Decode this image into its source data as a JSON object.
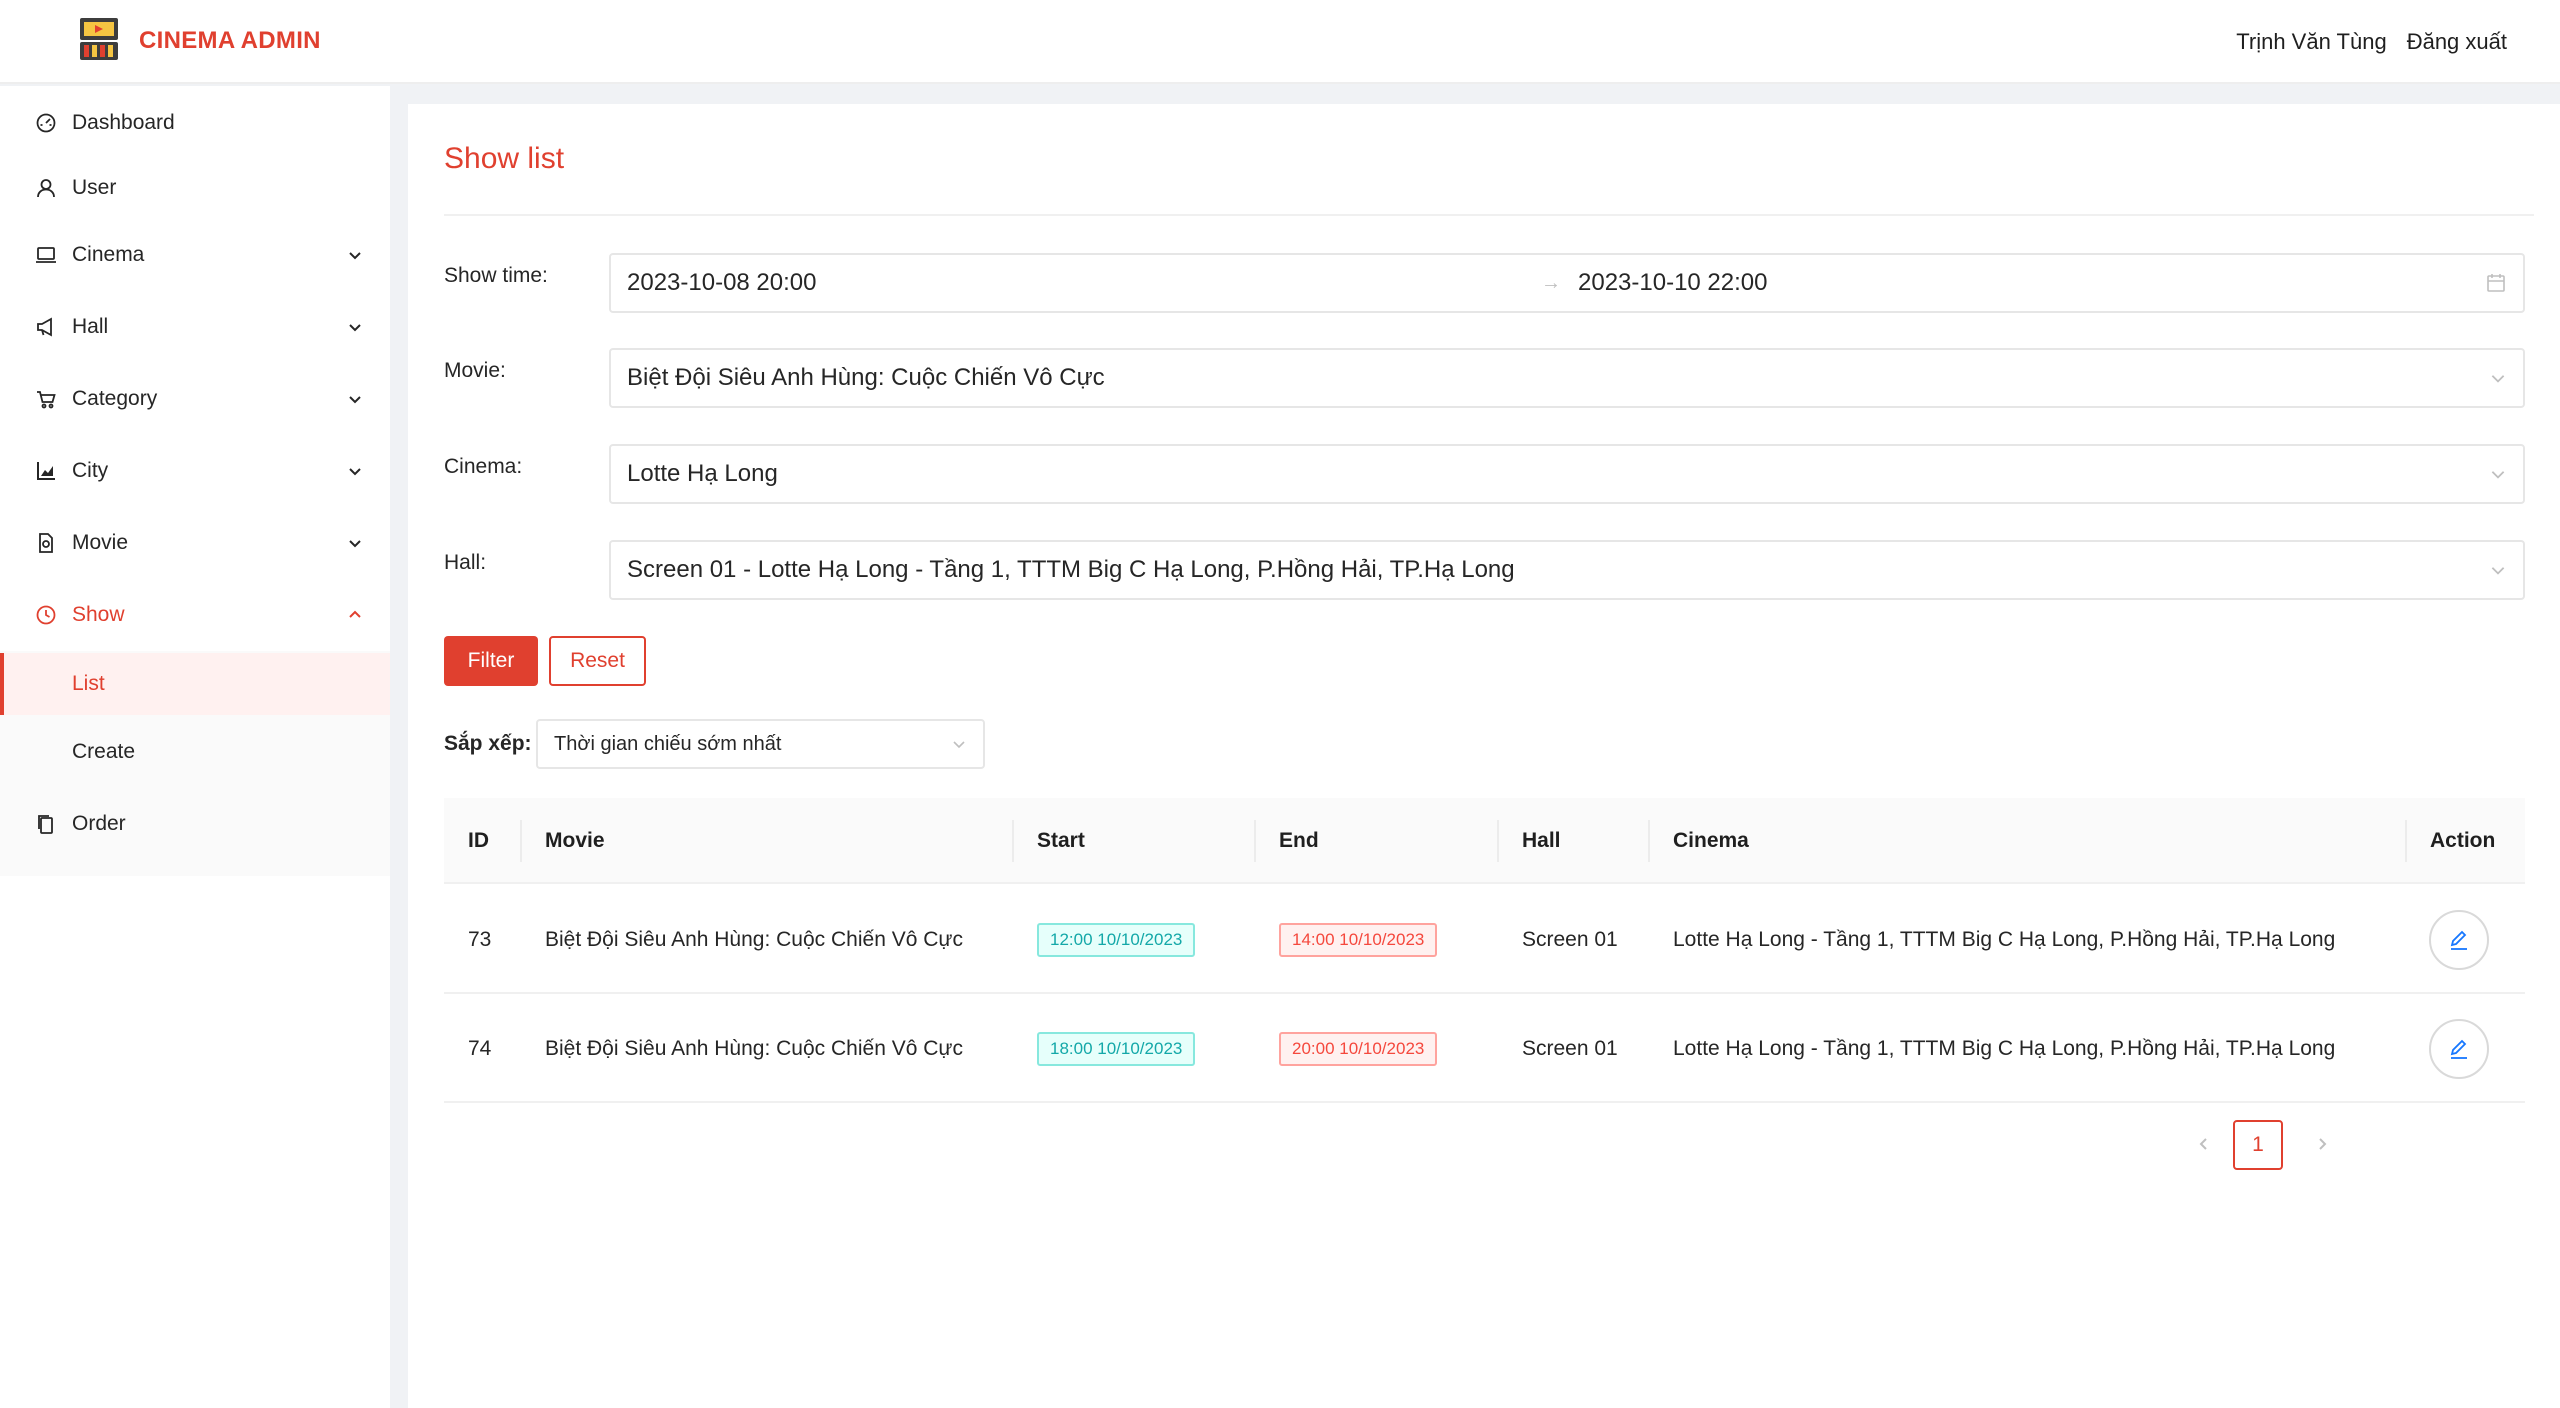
{
  "header": {
    "app_title": "CINEMA ADMIN",
    "user_name": "Trịnh Văn Tùng",
    "logout_label": "Đăng xuất"
  },
  "sidebar": {
    "items": [
      {
        "label": "Dashboard",
        "icon": "dashboard-icon"
      },
      {
        "label": "User",
        "icon": "user-icon"
      },
      {
        "label": "Cinema",
        "icon": "laptop-icon"
      },
      {
        "label": "Hall",
        "icon": "megaphone-icon"
      },
      {
        "label": "Category",
        "icon": "cart-icon"
      },
      {
        "label": "City",
        "icon": "chart-icon"
      },
      {
        "label": "Movie",
        "icon": "file-icon"
      },
      {
        "label": "Show",
        "icon": "clock-icon"
      },
      {
        "label": "Order",
        "icon": "copy-icon"
      }
    ],
    "show_submenu": [
      {
        "label": "List"
      },
      {
        "label": "Create"
      }
    ]
  },
  "page": {
    "title": "Show list"
  },
  "filters": {
    "show_time_label": "Show time",
    "show_time_start": "2023-10-08 20:00",
    "show_time_end": "2023-10-10 22:00",
    "movie_label": "Movie",
    "movie_value": "Biệt Đội Siêu Anh Hùng: Cuộc Chiến Vô Cực",
    "cinema_label": "Cinema",
    "cinema_value": "Lotte Hạ Long",
    "hall_label": "Hall",
    "hall_value": "Screen 01 - Lotte Hạ Long - Tầng 1, TTTM Big C Hạ Long, P.Hồng Hải, TP.Hạ Long",
    "filter_button": "Filter",
    "reset_button": "Reset"
  },
  "sort": {
    "label": "Sắp xếp:",
    "value": "Thời gian chiếu sớm nhất"
  },
  "table": {
    "headers": {
      "id": "ID",
      "movie": "Movie",
      "start": "Start",
      "end": "End",
      "hall": "Hall",
      "cinema": "Cinema",
      "action": "Action"
    },
    "rows": [
      {
        "id": "73",
        "movie": "Biệt Đội Siêu Anh Hùng: Cuộc Chiến Vô Cực",
        "start": "12:00 10/10/2023",
        "end": "14:00 10/10/2023",
        "hall": "Screen 01",
        "cinema": "Lotte Hạ Long - Tầng 1, TTTM Big C Hạ Long, P.Hồng Hải, TP.Hạ Long"
      },
      {
        "id": "74",
        "movie": "Biệt Đội Siêu Anh Hùng: Cuộc Chiến Vô Cực",
        "start": "18:00 10/10/2023",
        "end": "20:00 10/10/2023",
        "hall": "Screen 01",
        "cinema": "Lotte Hạ Long - Tầng 1, TTTM Big C Hạ Long, P.Hồng Hải, TP.Hạ Long"
      }
    ]
  },
  "pagination": {
    "current_page": "1"
  },
  "colors": {
    "accent": "#e0402f",
    "start_tag": "#13a8a8",
    "end_tag": "#f5483d"
  }
}
